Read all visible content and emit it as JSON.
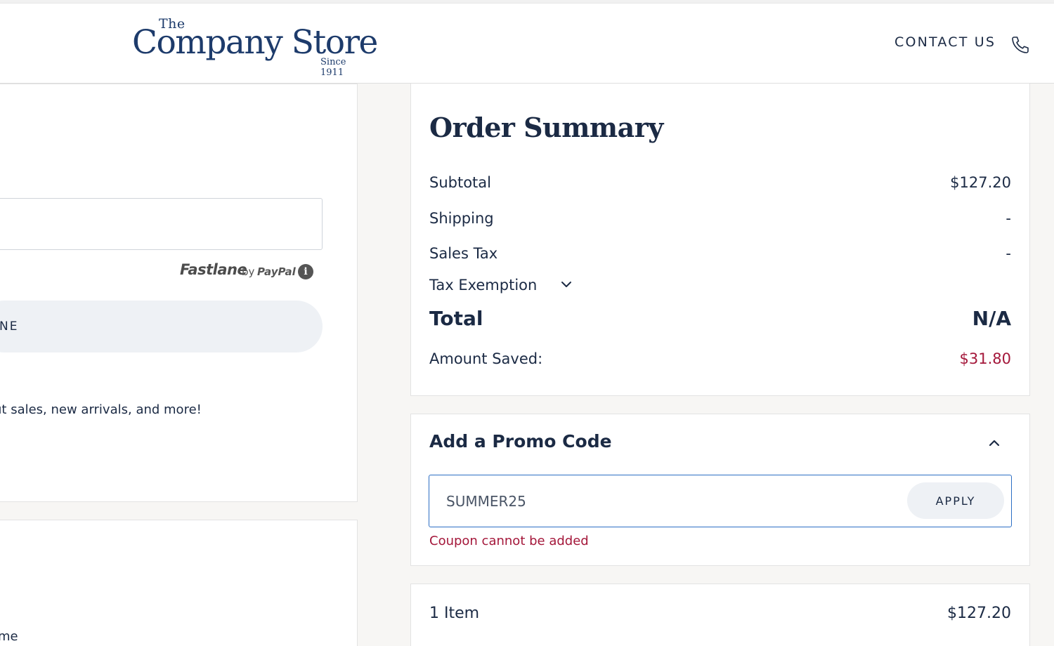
{
  "header": {
    "logo": {
      "the": "The",
      "main": "Company Store",
      "since": "Since 1911"
    },
    "contact_label": "CONTACT US",
    "contact_icon": "phone-icon"
  },
  "left": {
    "fastlane": {
      "brand": "Fastlane",
      "by": "by",
      "provider": "PayPal",
      "info_icon": "info-icon"
    },
    "pill_button_label": "NE",
    "newsletter_text": "ut sales, new arrivals, and more!",
    "bottom_text": "me"
  },
  "order_summary": {
    "title": "Order Summary",
    "rows": [
      {
        "label": "Subtotal",
        "value": "$127.20"
      },
      {
        "label": "Shipping",
        "value": "-"
      },
      {
        "label": "Sales Tax",
        "value": "-"
      }
    ],
    "tax_exemption_label": "Tax Exemption",
    "total_label": "Total",
    "total_value": "N/A",
    "saved_label": "Amount Saved:",
    "saved_value": "$31.80"
  },
  "promo": {
    "title": "Add a Promo Code",
    "code_value": "SUMMER25",
    "apply_label": "APPLY",
    "error": "Coupon cannot be added"
  },
  "items": {
    "label": "1 Item",
    "value": "$127.20"
  },
  "colors": {
    "navy": "#1b2a44",
    "error_red": "#a4173a",
    "focus_blue": "#2c6ec4",
    "pill_bg": "#eef1f5"
  }
}
